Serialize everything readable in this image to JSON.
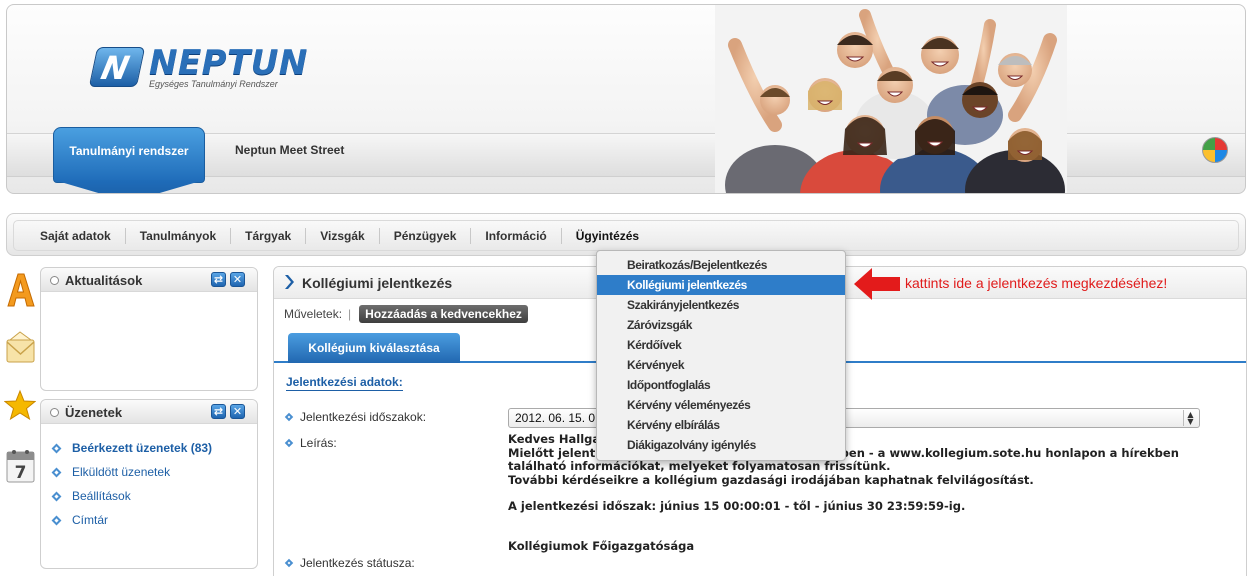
{
  "header": {
    "logo_text": "NEPTUN",
    "logo_subtitle": "Egységes Tanulmányi Rendszer",
    "tabs": [
      {
        "label": "Tanulmányi rendszer",
        "active": true
      },
      {
        "label": "Neptun Meet Street",
        "active": false
      }
    ]
  },
  "nav": {
    "items": [
      "Saját adatok",
      "Tanulmányok",
      "Tárgyak",
      "Vizsgák",
      "Pénzügyek",
      "Információ",
      "Ügyintézés"
    ],
    "open_item": "Ügyintézés"
  },
  "dropdown": {
    "items": [
      "Beiratkozás/Bejelentkezés",
      "Kollégiumi jelentkezés",
      "Szakirányjelentkezés",
      "Záróvizsgák",
      "Kérdőívek",
      "Kérvények",
      "Időpontfoglalás",
      "Kérvény véleményezés",
      "Kérvény elbírálás",
      "Diákigazolvány igénylés"
    ],
    "active_index": 1
  },
  "annotation": {
    "text": "kattints ide a jelentkezés megkezdéséhez!",
    "color": "#e01b1b"
  },
  "sidebar": {
    "news_panel": {
      "title": "Aktualitások"
    },
    "messages_panel": {
      "title": "Üzenetek",
      "links": [
        {
          "label": "Beérkezett üzenetek (83)",
          "bold": true
        },
        {
          "label": "Elküldött üzenetek",
          "bold": false
        },
        {
          "label": "Beállítások",
          "bold": false
        },
        {
          "label": "Címtár",
          "bold": false
        }
      ]
    },
    "calendar_day": "7"
  },
  "main": {
    "title": "Kollégiumi jelentkezés",
    "actions_label": "Műveletek:",
    "add_favorites_label": "Hozzáadás a kedvencekhez",
    "subtab": "Kollégium kiválasztása",
    "section_title": "Jelentkezési adatok:",
    "fields": {
      "period_label": "Jelentkezési időszakok:",
      "period_value": "2012. 06. 15. 0",
      "description_label": "Leírás:",
      "status_label": "Jelentkezés státusza:"
    },
    "description": {
      "line1": "Kedves Hallgat",
      "line2a": "Mielőtt jelentk",
      "line2b": "ükben - a www.kollegium.sote.hu honlapon a hírekben",
      "line3": "található információkat, melyeket folyamatosan frissítünk.",
      "line4": "További kérdéseikre a kollégium gazdasági irodájában kaphatnak felvilágosítást.",
      "line5": "A jelentkezési időszak: június 15 00:00:01 - től - június 30 23:59:59-ig.",
      "line6": "Kollégiumok Főigazgatósága"
    }
  },
  "colors": {
    "accent": "#2e7dc9",
    "link": "#1d5fa6",
    "annotation": "#e01b1b"
  }
}
